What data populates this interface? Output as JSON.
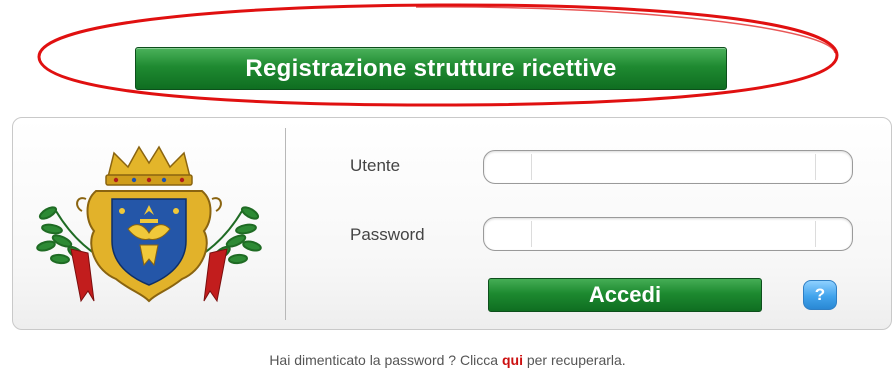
{
  "register_button": {
    "label": "Registrazione strutture ricettive"
  },
  "login_form": {
    "user_label": "Utente",
    "password_label": "Password",
    "user_value": "",
    "password_value": "",
    "login_button_label": "Accedi",
    "help_button_label": "?"
  },
  "forgot_password": {
    "prefix": "Hai dimenticato la password ? Clicca ",
    "link_text": "qui",
    "suffix": " per recuperarla."
  },
  "icons": {
    "coat_of_arms": "coat-of-arms-emblem",
    "highlight": "red-ellipse-annotation"
  },
  "colors": {
    "primary_green": "#1f8a31",
    "help_blue": "#41a3ec",
    "link_red": "#cc1010",
    "annotation_red": "#e01010"
  }
}
